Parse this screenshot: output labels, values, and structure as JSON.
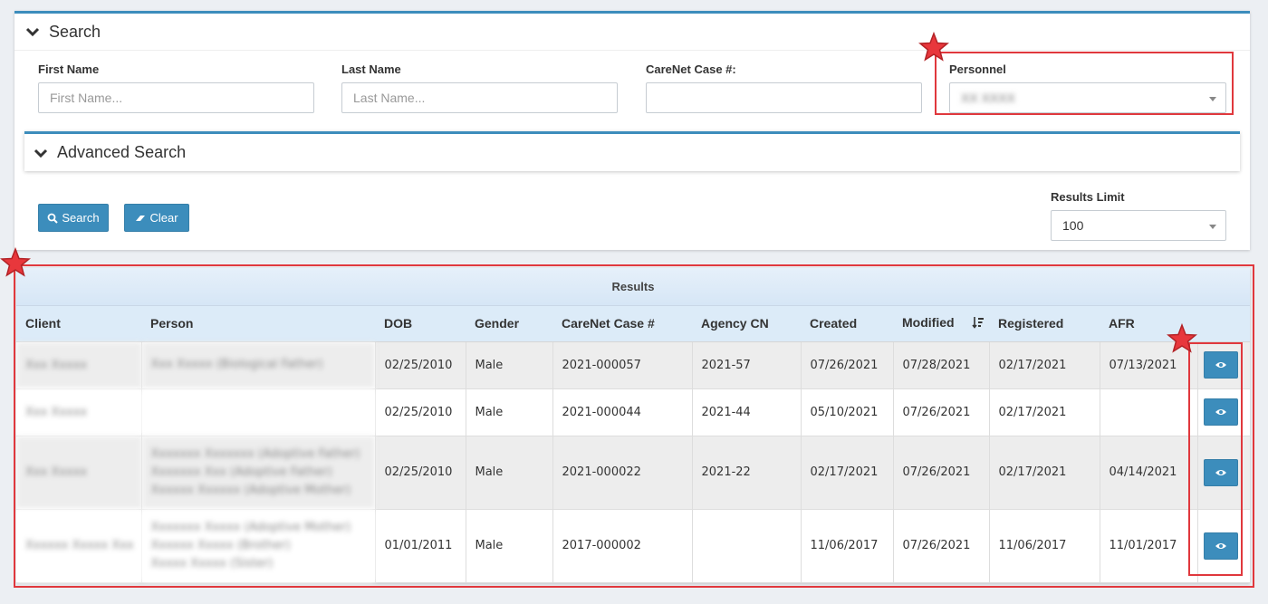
{
  "search_panel": {
    "title": "Search",
    "first_name": {
      "label": "First Name",
      "placeholder": "First Name..."
    },
    "last_name": {
      "label": "Last Name",
      "placeholder": "Last Name..."
    },
    "carenet_case": {
      "label": "CareNet Case #:",
      "placeholder": ""
    },
    "personnel": {
      "label": "Personnel",
      "value": "XX XXXX"
    },
    "advanced_title": "Advanced Search",
    "search_button": "Search",
    "clear_button": "Clear",
    "results_limit": {
      "label": "Results Limit",
      "value": "100"
    }
  },
  "results": {
    "title": "Results",
    "columns": [
      "Client",
      "Person",
      "DOB",
      "Gender",
      "CareNet Case #",
      "Agency CN",
      "Created",
      "Modified",
      "Registered",
      "AFR"
    ],
    "rows": [
      {
        "client": "Xxx Xxxxx",
        "person": [
          "Xxx Xxxxx (Biological Father)"
        ],
        "dob": "02/25/2010",
        "gender": "Male",
        "case": "2021-000057",
        "agency": "2021-57",
        "created": "07/26/2021",
        "modified": "07/28/2021",
        "registered": "02/17/2021",
        "afr": "07/13/2021"
      },
      {
        "client": "Xxx Xxxxx",
        "person": [],
        "dob": "02/25/2010",
        "gender": "Male",
        "case": "2021-000044",
        "agency": "2021-44",
        "created": "05/10/2021",
        "modified": "07/26/2021",
        "registered": "02/17/2021",
        "afr": ""
      },
      {
        "client": "Xxx Xxxxx",
        "person": [
          "Xxxxxxx Xxxxxxx (Adoptive Father)",
          "Xxxxxxx Xxx (Adoptive Father)",
          "Xxxxxx Xxxxxx (Adoptive Mother)"
        ],
        "dob": "02/25/2010",
        "gender": "Male",
        "case": "2021-000022",
        "agency": "2021-22",
        "created": "02/17/2021",
        "modified": "07/26/2021",
        "registered": "02/17/2021",
        "afr": "04/14/2021"
      },
      {
        "client": "Xxxxxx Xxxxx Xxx",
        "person": [
          "Xxxxxxx Xxxxx (Adoptive Mother)",
          "Xxxxxx Xxxxx (Brother)",
          "Xxxxx Xxxxx (Sister)"
        ],
        "dob": "01/01/2011",
        "gender": "Male",
        "case": "2017-000002",
        "agency": "",
        "created": "11/06/2017",
        "modified": "07/26/2021",
        "registered": "11/06/2017",
        "afr": "11/01/2017"
      }
    ]
  },
  "colors": {
    "primary": "#3c8dbc",
    "highlight": "#e0383d",
    "star": "#e8373c"
  },
  "icons": [
    "chevron-down-icon",
    "search-icon",
    "eraser-icon",
    "sort-desc-icon",
    "eye-icon",
    "star-icon"
  ]
}
